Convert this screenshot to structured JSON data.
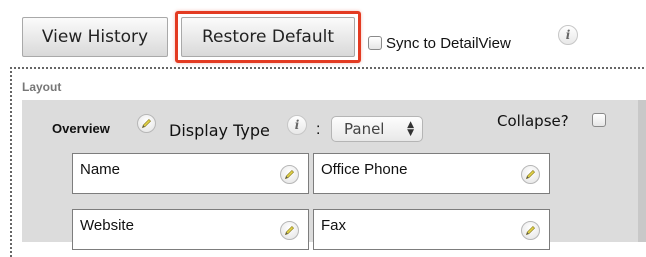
{
  "toolbar": {
    "view_history_label": "View History",
    "restore_default_label": "Restore Default",
    "sync_label": "Sync to DetailView",
    "info_glyph": "i"
  },
  "layout": {
    "title": "Layout",
    "panel": {
      "name": "Overview",
      "display_type_label": "Display Type",
      "separator": ":",
      "display_type_value": "Panel",
      "collapse_label": "Collapse?"
    },
    "fields": [
      {
        "label": "Name"
      },
      {
        "label": "Office Phone"
      },
      {
        "label": "Website"
      },
      {
        "label": "Fax"
      }
    ]
  },
  "icons": {
    "edit": "pencil-icon",
    "info": "info-icon",
    "select_arrows": "up-down-arrows-icon"
  },
  "colors": {
    "highlight": "#e33b22",
    "panel_background": "#dcdcdc",
    "pencil_accent": "#e2d44a"
  }
}
